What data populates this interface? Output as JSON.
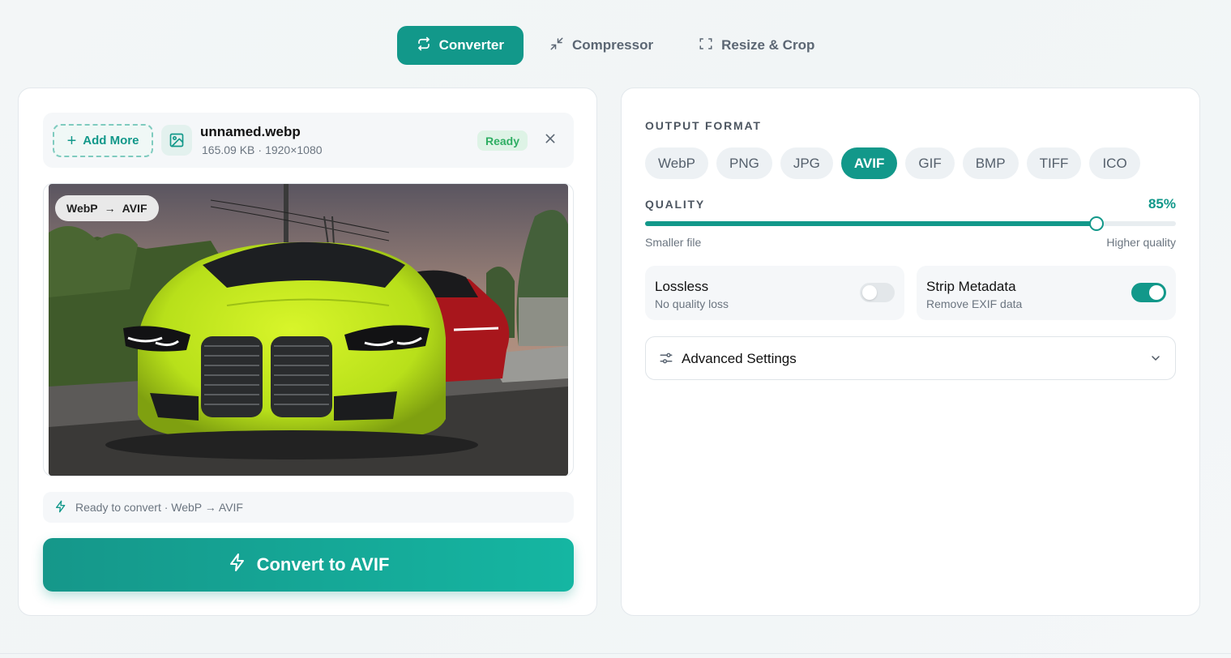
{
  "tabs": [
    {
      "label": "Converter",
      "icon": "repeat-icon",
      "active": true
    },
    {
      "label": "Compressor",
      "icon": "minimize-icon",
      "active": false
    },
    {
      "label": "Resize & Crop",
      "icon": "crop-frame-icon",
      "active": false
    }
  ],
  "file": {
    "add_more_label": "Add More",
    "name": "unnamed.webp",
    "size": "165.09 KB",
    "separator": "·",
    "dimensions": "1920×1080",
    "status": "Ready"
  },
  "preview": {
    "from_format": "WebP",
    "arrow": "→",
    "to_format": "AVIF"
  },
  "info_bar": {
    "text": "Ready to convert · WebP → AVIF"
  },
  "convert_button": {
    "label": "Convert to AVIF"
  },
  "output": {
    "section_label": "OUTPUT FORMAT",
    "formats": [
      "WebP",
      "PNG",
      "JPG",
      "AVIF",
      "GIF",
      "BMP",
      "TIFF",
      "ICO"
    ],
    "selected": "AVIF"
  },
  "quality": {
    "section_label": "QUALITY",
    "value_label": "85%",
    "value": 0.85,
    "min_caption": "Smaller file",
    "max_caption": "Higher quality"
  },
  "options": {
    "lossless": {
      "title": "Lossless",
      "subtitle": "No quality loss",
      "enabled": false
    },
    "strip_metadata": {
      "title": "Strip Metadata",
      "subtitle": "Remove EXIF data",
      "enabled": true
    }
  },
  "advanced": {
    "label": "Advanced Settings"
  },
  "colors": {
    "accent": "#12988a",
    "ready_green": "#2fae63"
  }
}
